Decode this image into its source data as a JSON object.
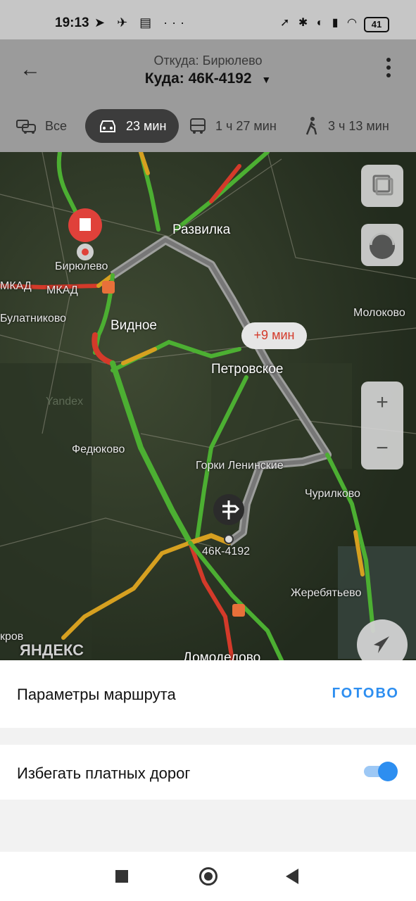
{
  "status_bar": {
    "time": "19:13",
    "battery": "41"
  },
  "header": {
    "from": "Откуда: Бирюлево",
    "to": "Куда: 46К-4192"
  },
  "modes": [
    {
      "label": "Все",
      "icon": "multimodal-icon"
    },
    {
      "label": "23 мин",
      "icon": "car-icon",
      "active": true
    },
    {
      "label": "1 ч 27 мин",
      "icon": "bus-icon"
    },
    {
      "label": "3 ч 13 мин",
      "icon": "walk-icon"
    }
  ],
  "map": {
    "labels": {
      "razvilka": "Развилка",
      "biryulevo": "Бирюлево",
      "mkad1": "МКАД",
      "mkad2": "МКАД",
      "bulatnikovo": "Булатниково",
      "vidnoe": "Видное",
      "molokovo": "Молоково",
      "petrovskoe": "Петровское",
      "yandex_wm": "Yandex",
      "fedyukovo": "Федюково",
      "gorki": "Горки Ленинские",
      "churilkovo": "Чурилково",
      "destination": "46К-4192",
      "zherebyatevo": "Жеребятьево",
      "krov": "кров",
      "yandex_logo": "ЯНДЕКС",
      "domodedovo": "Домодедово"
    },
    "alt_route_badge": "+9 мин"
  },
  "panel": {
    "title": "Параметры маршрута",
    "done": "ГОТОВО",
    "avoid_tolls": "Избегать платных дорог",
    "avoid_tolls_enabled": true
  }
}
